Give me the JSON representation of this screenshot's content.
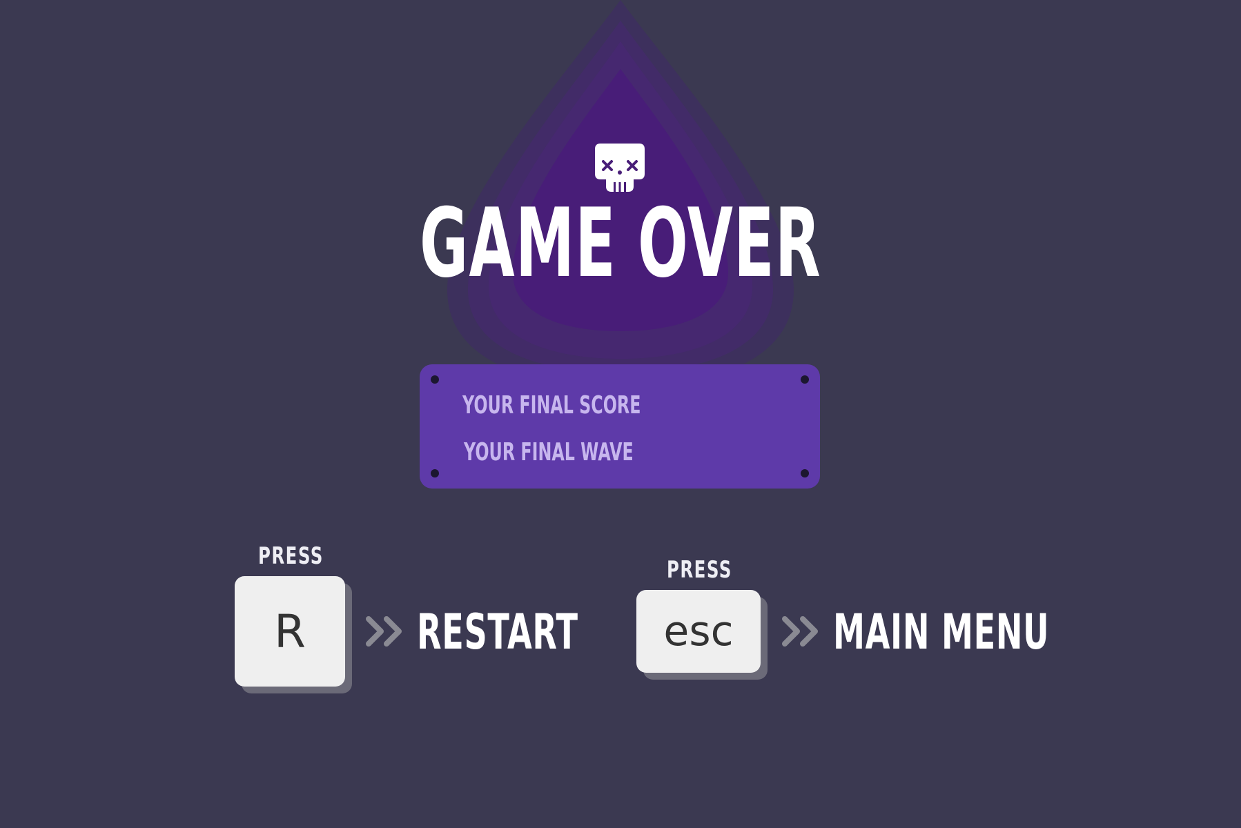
{
  "screen": {
    "title": "GAME OVER",
    "skull_icon": "skull-icon"
  },
  "stats_panel": {
    "score_label": "YOUR FINAL SCORE",
    "wave_label": "YOUR FINAL WAVE"
  },
  "controls": {
    "restart": {
      "press_label": "PRESS",
      "key": "R",
      "action": "RESTART"
    },
    "menu": {
      "press_label": "PRESS",
      "key": "esc",
      "action": "MAIN MENU"
    }
  },
  "colors": {
    "background": "#3b3951",
    "glow": "#481d78",
    "panel": "#5e3aa9",
    "panel_text": "#c7b6ee",
    "key": "#efefef",
    "chevron": "#8a8a93"
  }
}
